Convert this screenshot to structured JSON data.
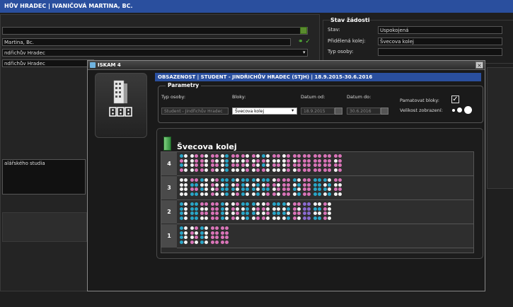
{
  "window": {
    "title": "HŮV HRADEC | IVANIČOVÁ MARTINA, BC."
  },
  "background": {
    "fields": [
      "",
      "Martina, Bc.",
      "ndřichův Hradec",
      "ndřichův Hradec"
    ],
    "note": "alářského studia",
    "stav": {
      "legend": "Stav žádosti",
      "stav_label": "Stav:",
      "stav_value": "Uspokojená",
      "kolej_label": "Přidělená kolej:",
      "kolej_value": "Švecova kolej",
      "typ_label": "Typ osoby:",
      "typ_value": ""
    }
  },
  "dialog": {
    "title": "ISKAM 4",
    "close": "×",
    "header": "OBSAZENOST | STUDENT - JINDŘICHŮV HRADEC   (STJH) | 18.9.2015-30.6.2016",
    "params": {
      "legend": "Parametry",
      "typ_label": "Typ osoby:",
      "typ_value": "Student - Jindřichův Hradec",
      "bloky_label": "Bloky:",
      "bloky_value": "Švecova kolej",
      "od_label": "Datum od:",
      "od_value": "18.9.2015",
      "do_label": "Datum do:",
      "do_value": "30.6.2016",
      "pamatovat_label": "Pamatovat bloky:",
      "pamatovat_checked": "✓",
      "velikost_label": "Velikost zobrazení:"
    },
    "building": {
      "name": "Švecova kolej",
      "floors": [
        {
          "label": "4",
          "rooms": [
            "cwpw",
            "wpwp",
            "pwpw",
            "pppw",
            "wcwc",
            "ppww",
            "pwwp",
            "pwwp",
            "cwpw",
            "ppww",
            "wpwp",
            "ppwp",
            "pppp",
            "pppp",
            "pppp",
            "ppwp"
          ]
        },
        {
          "label": "3",
          "rooms": [
            "wwww",
            "ppcc",
            "cwww",
            "wppw",
            "ccwc",
            "cwwp",
            "cccw",
            "cwwc",
            "ccwp",
            "wppw",
            "pppp",
            "cwwc",
            "pppp",
            "cccc",
            "cwwc",
            "ppww"
          ]
        },
        {
          "label": "2",
          "rooms": [
            "cwcw",
            "cccc",
            "ppww",
            "pppp",
            "cwcw",
            "wppw",
            "ccwc",
            "cwwp",
            "wppw",
            "ccww",
            "cwwc",
            "pppw",
            "vvvv",
            "wwcc",
            "pwpw"
          ]
        },
        {
          "label": "1",
          "rooms": [
            "cwcw",
            "wppw",
            "cwcw",
            "pppp",
            "pppp"
          ]
        }
      ]
    }
  },
  "colors": {
    "accent": "#2a4f9e",
    "cyan_bed": "#29a6c8",
    "pink_bed": "#d974b8",
    "white_bed": "#f2f2f2",
    "violet_bed": "#8a6ad0"
  }
}
